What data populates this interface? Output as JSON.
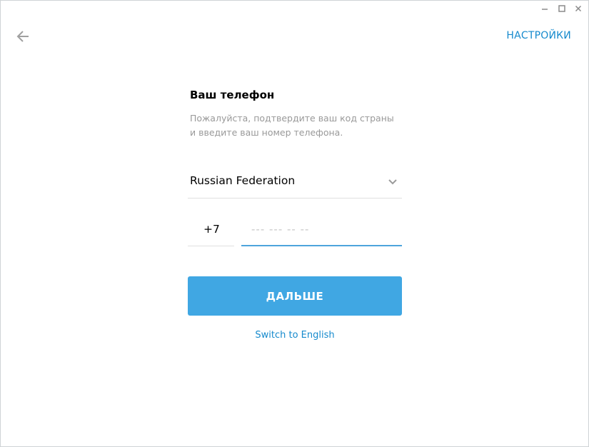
{
  "window": {
    "controls": {
      "minimize_icon": "minimize-icon",
      "maximize_icon": "maximize-icon",
      "close_icon": "close-icon"
    }
  },
  "header": {
    "back_icon": "arrow-left-icon",
    "settings_label": "НАСТРОЙКИ"
  },
  "form": {
    "title": "Ваш телефон",
    "description": "Пожалуйста, подтвердите ваш код страны и введите ваш номер телефона.",
    "country": {
      "selected": "Russian Federation",
      "icon": "chevron-down-icon"
    },
    "phone": {
      "code": "+7",
      "value": "",
      "placeholder": "--- --- -- --"
    },
    "next_label": "ДАЛЬШЕ",
    "switch_language_label": "Switch to English"
  },
  "colors": {
    "accent": "#40a7e3",
    "link": "#168acd",
    "input_focus": "#4ea4dc",
    "muted_text": "#999999"
  }
}
